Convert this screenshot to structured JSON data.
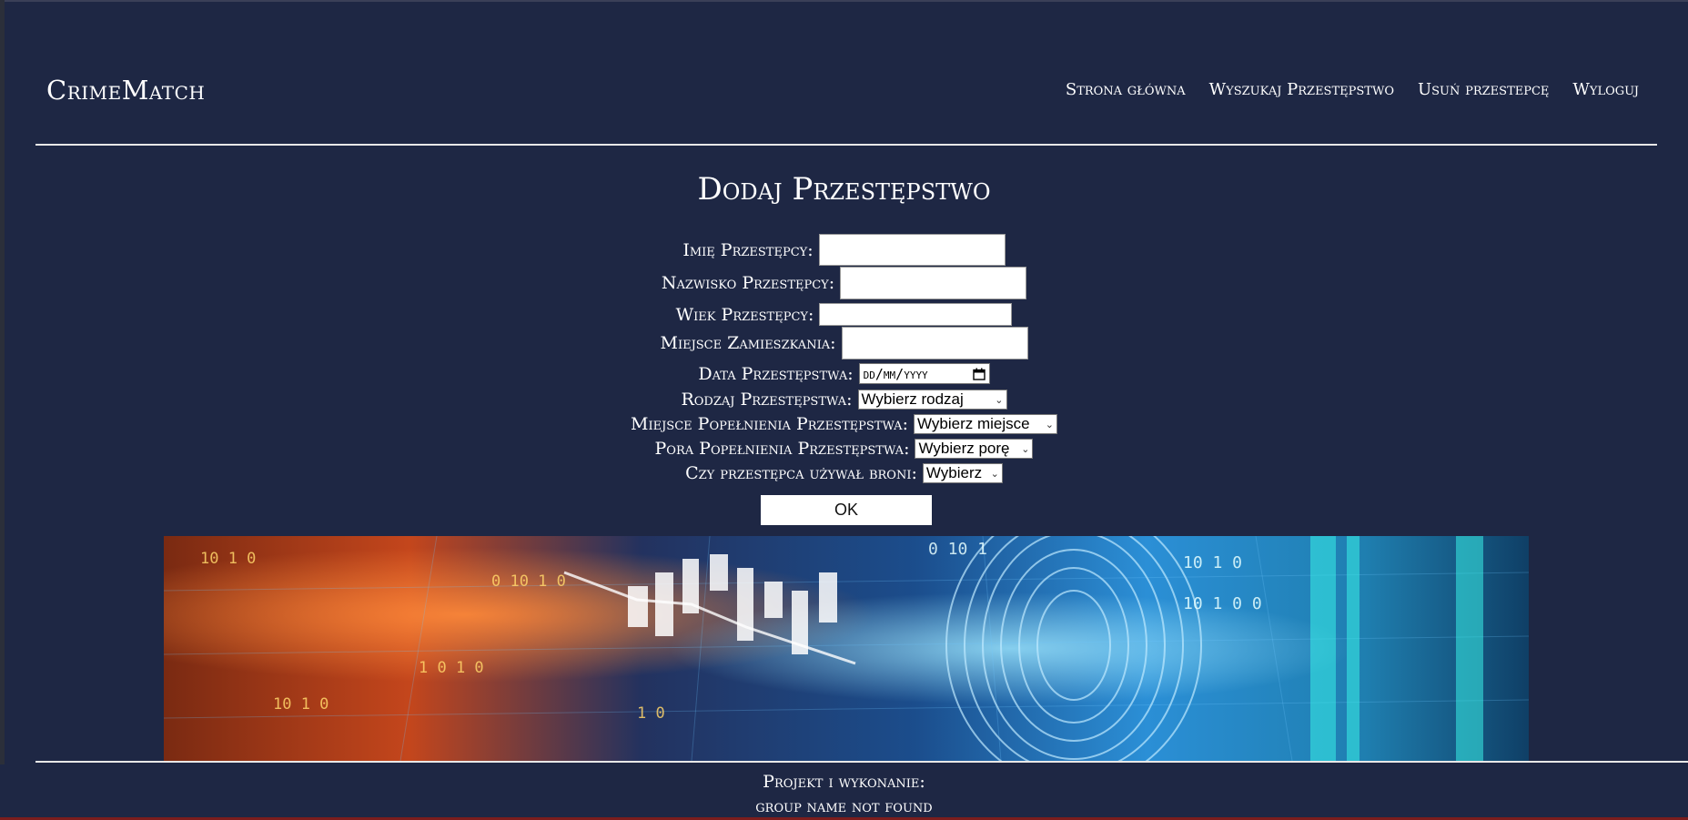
{
  "header": {
    "brand": "CrimeMatch",
    "nav": [
      "Strona główna",
      "Wyszukaj Przestępstwo",
      "Usuń przestepcę",
      "Wyloguj"
    ]
  },
  "form": {
    "title": "Dodaj Przestępstwo",
    "first_name_label": "Imię Przestępcy:",
    "last_name_label": "Nazwisko Przestępcy:",
    "age_label": "Wiek Przestępcy:",
    "residence_label": "Miejsce Zamieszkania:",
    "date_label": "Data Przestępstwa:",
    "date_placeholder": "dd/mm/yyyy",
    "type_label": "Rodzaj Przestępstwa:",
    "type_value": "Wybierz rodzaj",
    "place_label": "Miejsce Popełnienia Przestępstwa:",
    "place_value": "Wybierz miejsce",
    "time_label": "Pora Popełnienia Przestępstwa:",
    "time_value": "Wybierz porę",
    "weapon_label": "Czy przestępca używał broni:",
    "weapon_value": "Wybierz",
    "submit": "OK"
  },
  "banner": {
    "binary_text": [
      "10 1 0",
      "0 10 1 0",
      "1 0 1 0",
      "10 1 0",
      "1 0",
      "0 10 1",
      "10 1 0 0"
    ]
  },
  "footer": {
    "line1": "Projekt i wykonanie:",
    "line2": "group name not found"
  },
  "colors": {
    "background": "#1e2744",
    "text": "#ffffff"
  }
}
